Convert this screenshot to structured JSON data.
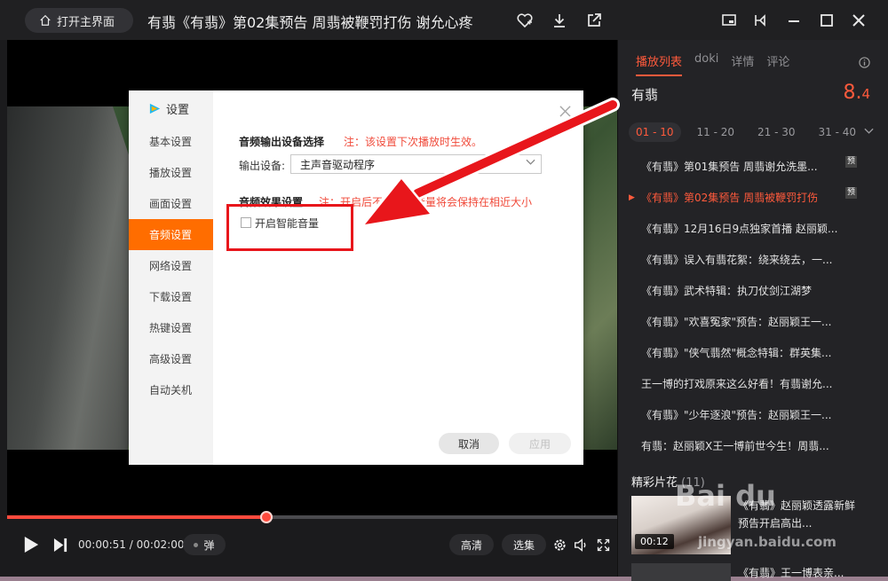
{
  "titlebar": {
    "home_label": "打开主界面",
    "title": "有翡《有翡》第02集预告 周翡被鞭罚打伤 谢允心疼"
  },
  "player": {
    "time_text": "00:00:51 / 00:02:00",
    "progress_fraction": 0.425,
    "danmu_label": "弹",
    "quality_label": "高清",
    "episodes_label": "选集"
  },
  "sidebar": {
    "tabs": [
      "播放列表",
      "doki",
      "详情",
      "评论"
    ],
    "show_name": "有翡",
    "rating_int": "8.",
    "rating_dec": "4",
    "ranges": [
      "01 - 10",
      "11 - 20",
      "21 - 30",
      "31 - 40"
    ],
    "episodes": [
      {
        "title": "《有翡》第01集预告 周翡谢允洗墨...",
        "badge": "预"
      },
      {
        "title": "《有翡》第02集预告 周翡被鞭罚打伤",
        "badge": "预"
      },
      {
        "title": "《有翡》12月16日9点独家首播 赵丽颖...",
        "badge": ""
      },
      {
        "title": "《有翡》误入有翡花絮：绕来绕去，一...",
        "badge": ""
      },
      {
        "title": "《有翡》武术特辑：执刀仗剑江湖梦",
        "badge": ""
      },
      {
        "title": "《有翡》\"欢喜冤家\"预告：赵丽颖王一...",
        "badge": ""
      },
      {
        "title": "《有翡》\"侠气翡然\"概念特辑：群英集...",
        "badge": ""
      },
      {
        "title": "王一博的打戏原来这么好看！有翡谢允...",
        "badge": ""
      },
      {
        "title": "《有翡》\"少年逐浪\"预告：赵丽颖王一...",
        "badge": ""
      },
      {
        "title": "有翡：赵丽颖X王一博前世今生！周翡...",
        "badge": ""
      }
    ],
    "clips_title": "精彩片花",
    "clips_count": "(11)",
    "clip_time": "00:12",
    "clip_title": "《有翡》赵丽颖透露新鲜预告开启高出...",
    "clip2_title": "《有翡》王一博表亲..."
  },
  "dialog": {
    "logo_text": "设置",
    "nav": [
      "基本设置",
      "播放设置",
      "画面设置",
      "音频设置",
      "网络设置",
      "下载设置",
      "热键设置",
      "高级设置",
      "自动关机"
    ],
    "output_section_title": "音频输出设备选择",
    "output_note": "注：该设置下次播放时生效。",
    "output_label": "输出设备:",
    "output_value": "主声音驱动程序",
    "effect_section_title": "音频效果设置",
    "effect_note": "注：开启后不同视频音量将会保持在相近大小",
    "checkbox_label": "开启智能音量",
    "cancel_label": "取消",
    "apply_label": "应用"
  },
  "watermark": {
    "main": "Bai du",
    "sub": "jingyan.baidu.com"
  },
  "colors": {
    "accent": "#ff5a3c",
    "dialog_active": "#ff6d00",
    "annotation_red": "#e8161b"
  }
}
